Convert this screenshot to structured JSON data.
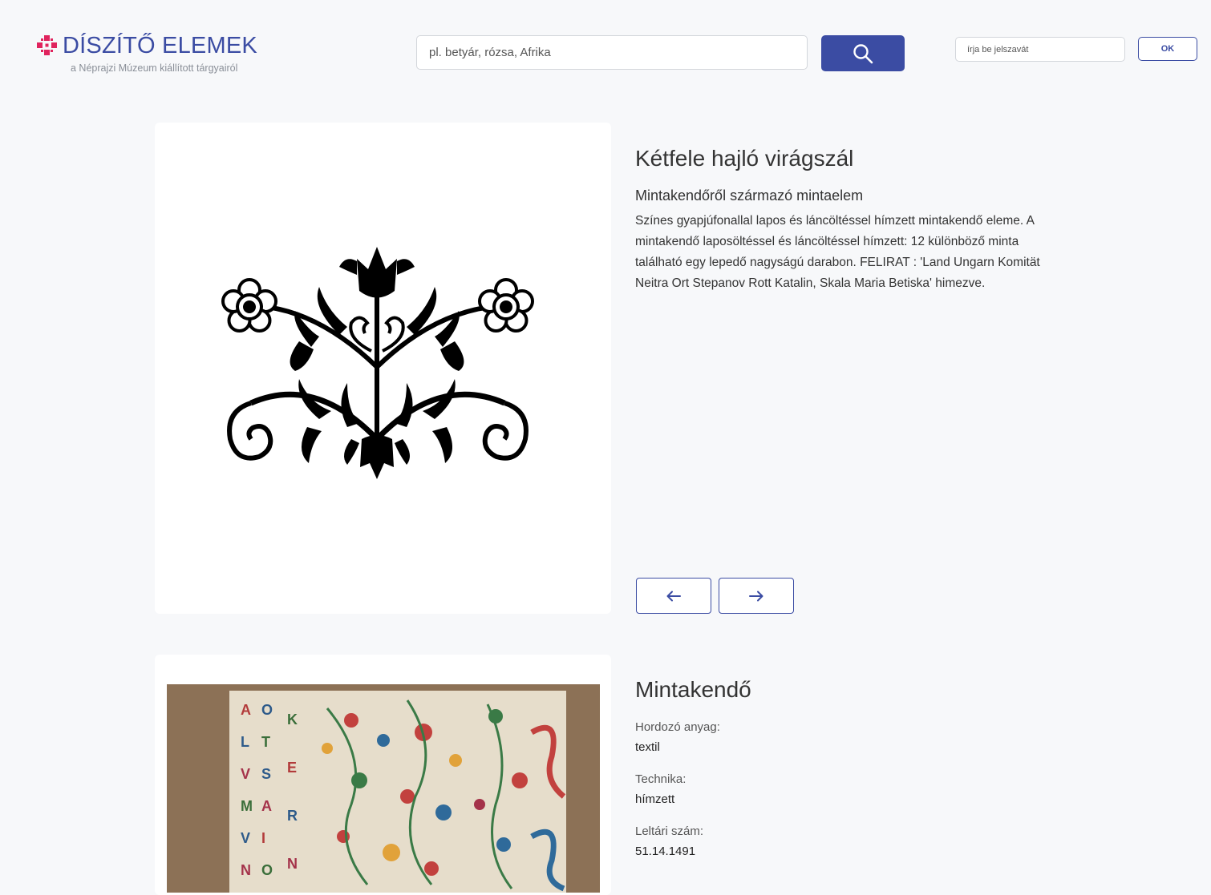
{
  "header": {
    "logo_title": "DÍSZÍTŐ ELEMEK",
    "logo_subtitle": "a Néprajzi Múzeum kiállított tárgyairól",
    "search_placeholder": "pl. betyár, rózsa, Afrika",
    "search_icon": "magnifier-icon",
    "password_placeholder": "írja be jelszavát",
    "ok_label": "OK",
    "colors": {
      "brand_blue": "#3b4ca3",
      "brand_pink": "#e0245e"
    }
  },
  "element": {
    "title": "Kétfele hajló virágszál",
    "subtitle": "Mintakendőről származó mintaelem",
    "description": "Színes gyapjúfonallal lapos és láncöltéssel hímzett mintakendő eleme. A mintakendő laposöltéssel és láncöltéssel hímzett: 12 különböző minta található egy lepedő nagyságú darabon. FELIRAT : 'Land Ungarn Komität Neitra Ort Stepanov Rott Katalin, Skala Maria Betiska' himezve.",
    "image_icon": "floral-motif-icon"
  },
  "navigation": {
    "prev_icon": "arrow-left-icon",
    "next_icon": "arrow-right-icon"
  },
  "object": {
    "title": "Mintakendő",
    "photo_icon": "embroidered-cloth-photo",
    "fields": [
      {
        "label": "Hordozó anyag:",
        "value": "textil"
      },
      {
        "label": "Technika:",
        "value": "hímzett"
      },
      {
        "label": "Leltári szám:",
        "value": "51.14.1491"
      }
    ]
  }
}
